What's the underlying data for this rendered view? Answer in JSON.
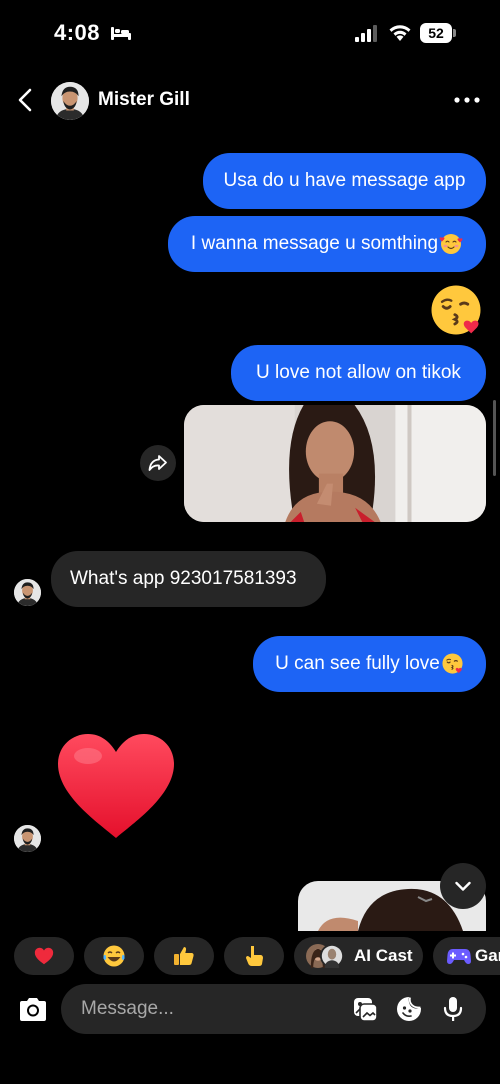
{
  "status_bar": {
    "time": "4:08",
    "battery_level": "52",
    "icons": [
      "bed-icon",
      "signal-icon",
      "wifi-icon",
      "battery-icon"
    ]
  },
  "header": {
    "contact_name": "Mister Gill",
    "icons": [
      "back-icon",
      "avatar",
      "more-options-icon"
    ]
  },
  "messages": [
    {
      "direction": "outgoing",
      "type": "text",
      "text": "Usa do u have message app"
    },
    {
      "direction": "outgoing",
      "type": "text",
      "text": "I wanna message u somthing",
      "emoji": "smiling-face-with-hearts"
    },
    {
      "direction": "outgoing",
      "type": "emoji",
      "emoji": "face-blowing-a-kiss"
    },
    {
      "direction": "outgoing",
      "type": "text",
      "text": "U love not allow on tikok"
    },
    {
      "direction": "outgoing",
      "type": "photo"
    },
    {
      "direction": "incoming",
      "type": "text",
      "text": "What's app 923017581393"
    },
    {
      "direction": "outgoing",
      "type": "text",
      "text": "U can see fully love",
      "emoji": "face-blowing-a-kiss"
    },
    {
      "direction": "incoming",
      "type": "emoji",
      "emoji": "red-heart"
    },
    {
      "direction": "outgoing",
      "type": "photo"
    }
  ],
  "quick_replies": [
    {
      "icon": "red-heart-icon"
    },
    {
      "icon": "tears-of-joy-icon"
    },
    {
      "icon": "thumbs-up-icon"
    },
    {
      "icon": "pointing-down-icon"
    },
    {
      "icon": "ai-cast-avatars",
      "label": "AI Cast"
    },
    {
      "icon": "game-controller-icon",
      "label": "Gam"
    }
  ],
  "composer": {
    "placeholder": "Message...",
    "icons": [
      "camera-icon",
      "gallery-icon",
      "sticker-icon",
      "microphone-icon"
    ]
  },
  "colors": {
    "background": "#000000",
    "outgoing_bubble": "#1d64f5",
    "incoming_bubble": "#262626",
    "heart": "#f2213b",
    "game_icon": "#6b5cff"
  }
}
